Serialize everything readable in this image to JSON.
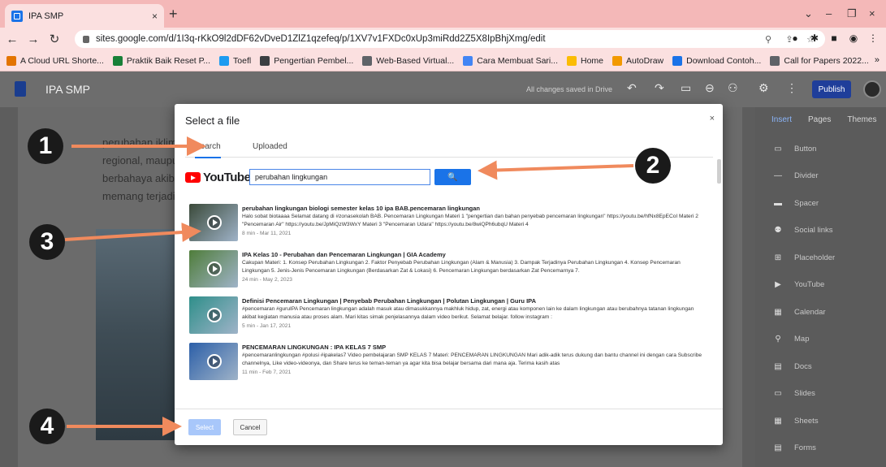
{
  "browser": {
    "tab_title": "IPA SMP",
    "tab_close": "×",
    "new_tab": "+",
    "url": "sites.google.com/d/1I3q-rKkO9l2dDF62vDveD1ZlZ1qzefeq/p/1XV7v1FXDc0xUp3miRdd2Z5X8IpBhjXmg/edit",
    "window_controls": [
      "⌄",
      "–",
      "❐",
      "×"
    ]
  },
  "bookmarks": {
    "items": [
      {
        "label": "A Cloud URL Shorte...",
        "color": "#e37400"
      },
      {
        "label": "Praktik Baik Reset P...",
        "color": "#188038"
      },
      {
        "label": "Toefl",
        "color": "#1d9bf0"
      },
      {
        "label": "Pengertian Pembel...",
        "color": "#3c4043"
      },
      {
        "label": "Web-Based Virtual...",
        "color": "#5f6368"
      },
      {
        "label": "Cara Membuat Sari...",
        "color": "#4285f4"
      },
      {
        "label": "Home",
        "color": "#fbbc04"
      },
      {
        "label": "AutoDraw",
        "color": "#f29900"
      },
      {
        "label": "Download Contoh...",
        "color": "#1a73e8"
      },
      {
        "label": "Call for Papers 2022...",
        "color": "#5f6368"
      }
    ],
    "more": "»"
  },
  "sites": {
    "site_name": "IPA SMP",
    "saved_status": "All changes saved in Drive",
    "publish_label": "Publish",
    "panel_tabs": [
      "Insert",
      "Pages",
      "Themes"
    ],
    "panel_items": [
      {
        "label": "Button",
        "icon": "button-icon"
      },
      {
        "label": "Divider",
        "icon": "divider-icon"
      },
      {
        "label": "Spacer",
        "icon": "spacer-icon"
      },
      {
        "label": "Social links",
        "icon": "social-links-icon"
      },
      {
        "label": "Placeholder",
        "icon": "placeholder-icon"
      },
      {
        "label": "YouTube",
        "icon": "youtube-icon"
      },
      {
        "label": "Calendar",
        "icon": "calendar-icon"
      },
      {
        "label": "Map",
        "icon": "map-pin-icon"
      },
      {
        "label": "Docs",
        "icon": "docs-icon"
      },
      {
        "label": "Slides",
        "icon": "slides-icon"
      },
      {
        "label": "Sheets",
        "icon": "sheets-icon"
      },
      {
        "label": "Forms",
        "icon": "forms-icon"
      }
    ],
    "background_lines": [
      "perubahan iklim ad",
      "regional, maupun gl",
      "berbahaya akibat ak",
      "memang terjadi akib"
    ]
  },
  "dialog": {
    "title": "Select a file",
    "close": "×",
    "tabs": [
      "Search",
      "Uploaded"
    ],
    "youtube_word": "YouTube",
    "search_value": "perubahan lingkungan",
    "search_button_icon": "🔍",
    "results": [
      {
        "title": "perubahan lingkungan biologi semester kelas 10 ipa BAB.pencemaran lingkungan",
        "description": "Halo sobat biotaaaa Selamat datang di #zonasekolah BAB. Pencemaran Lingkungan Materi 1 \"pengertian dan bahan penyebab pencemaran lingkungan\" https://youtu.be/hfNx8EpECoI Materi 2 \"Pencemaran Air\" https://youtu.be/JpMiQzW3WxY Materi 3 \"Pencemaran Udara\" https://youtu.be/8wiQPh6ubqU Materi 4",
        "meta": "8 min - Mar 11, 2021",
        "thumb_color": "#3b4a3a"
      },
      {
        "title": "IPA Kelas 10 - Perubahan dan Pencemaran Lingkungan | GIA Academy",
        "description": "Cakupan Materi: 1. Konsep Perubahan Lingkungan 2. Faktor Penyebab Perubahan Lingkungan (Alam & Manusia) 3. Dampak Terjadinya Perubahan Lingkungan 4. Konsep Pencemaran Lingkungan 5. Jenis-Jenis Pencemaran Lingkungan (Berdasarkan Zat & Lokasi) 6. Pencemaran Lingkungan berdasarkan Zat Pencemarnya 7.",
        "meta": "24 min - May 2, 2023",
        "thumb_color": "#4f7d3a"
      },
      {
        "title": "Definisi Pencemaran Lingkungan | Penyebab Perubahan Lingkungan | Polutan Lingkungan | Guru IPA",
        "description": "#pencemaran #guruIPA Pencemaran lingkungan adalah masuk atau dimasukkannya makhluk hidup, zat, energi atau komponen lain ke dalam lingkungan atau berubahnya tatanan lingkungan akibat kegiatan manusia atau proses alam. Mari kitas simak penjelasannya dalam video berikut. Selamat belajar. follow instagram :",
        "meta": "5 min - Jan 17, 2021",
        "thumb_color": "#2f8f8a"
      },
      {
        "title": "PENCEMARAN LINGKUNGAN : IPA KELAS 7 SMP",
        "description": "#pencemaranlingkungan #polusi #ipakelas7 Video pembelajaran SMP KELAS 7 Materi: PENCEMARAN LINGKUNGAN Mari adik-adik terus dukung dan bantu channel ini dengan cara Subscribe channelnya, Like video-videonya, dan Share terus ke teman-teman ya agar kita bisa belajar bersama dari mana aja. Terima kasih atas",
        "meta": "11 min - Feb 7, 2021",
        "thumb_color": "#2c5fa8"
      }
    ],
    "select_label": "Select",
    "cancel_label": "Cancel"
  },
  "callouts": [
    "1",
    "2",
    "3",
    "4"
  ],
  "colors": {
    "arrow": "#f08a5d",
    "accent": "#1a73e8"
  }
}
